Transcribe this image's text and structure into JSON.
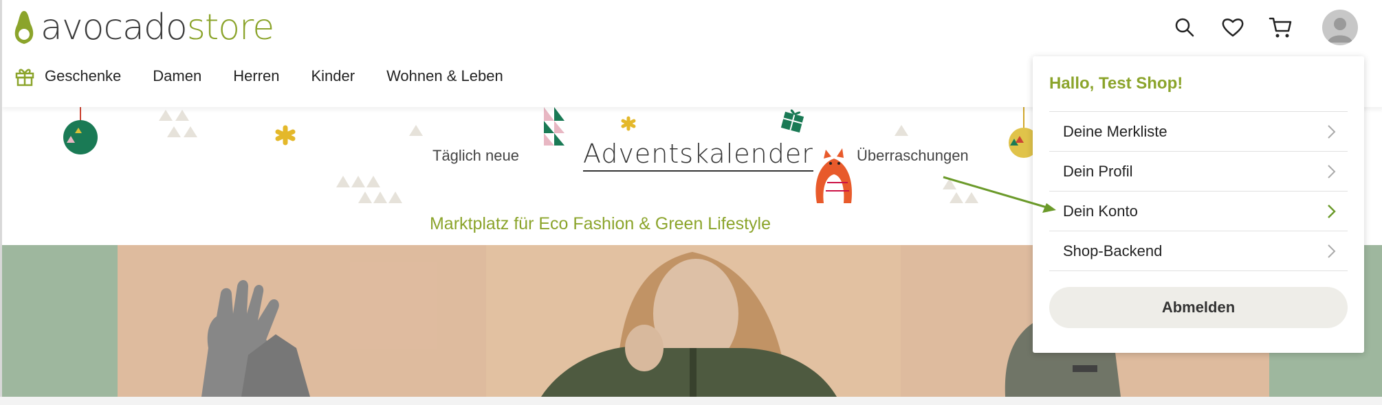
{
  "logo": {
    "part1": "avocado",
    "part2": "store"
  },
  "nav": {
    "items": [
      {
        "label": "Geschenke"
      },
      {
        "label": "Damen"
      },
      {
        "label": "Herren"
      },
      {
        "label": "Kinder"
      },
      {
        "label": "Wohnen & Leben"
      }
    ]
  },
  "header_icons": [
    "search-icon",
    "heart-icon",
    "cart-icon",
    "avatar"
  ],
  "banner": {
    "text_left": "Täglich neue",
    "title": "Adventskalender",
    "text_right": "Überraschungen",
    "subtitle": "Marktplatz für Eco Fashion & Green Lifestyle"
  },
  "account_menu": {
    "greeting": "Hallo, Test Shop!",
    "items": [
      {
        "label": "Deine Merkliste"
      },
      {
        "label": "Dein Profil"
      },
      {
        "label": "Dein Konto"
      },
      {
        "label": "Shop-Backend"
      }
    ],
    "logout_label": "Abmelden"
  },
  "colors": {
    "brand_green": "#8ba42b",
    "arrow_green": "#6b9a2a",
    "text": "#222222"
  }
}
